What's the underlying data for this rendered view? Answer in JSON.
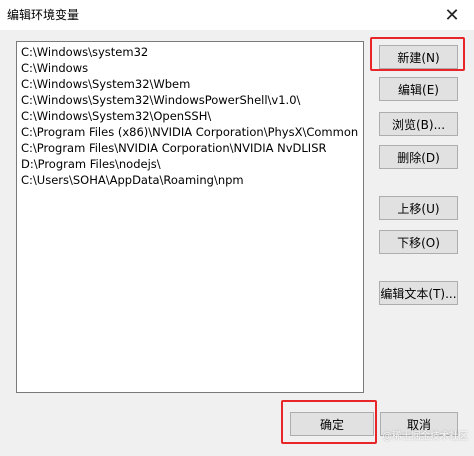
{
  "window": {
    "title": "编辑环境变量",
    "close_glyph": "✕"
  },
  "paths": [
    "C:\\Windows\\system32",
    "C:\\Windows",
    "C:\\Windows\\System32\\Wbem",
    "C:\\Windows\\System32\\WindowsPowerShell\\v1.0\\",
    "C:\\Windows\\System32\\OpenSSH\\",
    "C:\\Program Files (x86)\\NVIDIA Corporation\\PhysX\\Common",
    "C:\\Program Files\\NVIDIA Corporation\\NVIDIA NvDLISR",
    "D:\\Program Files\\nodejs\\",
    "C:\\Users\\SOHA\\AppData\\Roaming\\npm"
  ],
  "buttons": {
    "new": "新建(N)",
    "edit": "编辑(E)",
    "browse": "浏览(B)...",
    "delete": "删除(D)",
    "move_up": "上移(U)",
    "move_down": "下移(O)",
    "edit_text": "编辑文本(T)...",
    "ok": "确定",
    "cancel": "取消"
  },
  "highlight_color": "#e8262a",
  "watermark": "@稀土掘金技术社区"
}
